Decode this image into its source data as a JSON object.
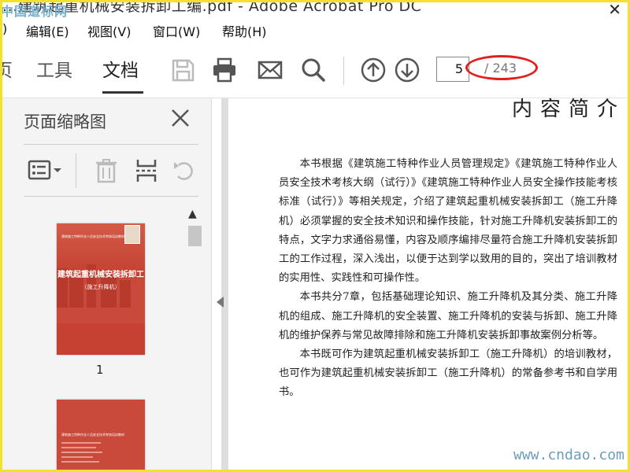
{
  "window": {
    "title": "...建筑起重机械安装拆卸工编.pdf - Adobe Acrobat Pro DC",
    "watermark_logo": "中国道标网"
  },
  "menu": [
    {
      "label": ")"
    },
    {
      "label": "编辑(E)"
    },
    {
      "label": "视图(V)"
    },
    {
      "label": "窗口(W)"
    },
    {
      "label": "帮助(H)"
    }
  ],
  "toolbar": {
    "tabs": [
      {
        "label": "页"
      },
      {
        "label": "工具"
      },
      {
        "label": "文档"
      }
    ],
    "current_page": "5",
    "total_pages": "/ 243",
    "annotation_color": "#e02020"
  },
  "sidebar": {
    "title": "页面缩略图",
    "thumbnails": [
      {
        "page_number": "1",
        "title": "建筑起重机械安装拆卸工",
        "subtitle": "（施工升降机）",
        "series": "建筑施工特种作业人员安全技术考核培训教材",
        "cover_color": "#c94a3a"
      },
      {
        "page_number": "",
        "series": "建筑施工特种作业人员安全技术考核培训教材",
        "cover_color": "#c94a3a"
      }
    ]
  },
  "document": {
    "heading": "内容简介",
    "paragraphs": [
      "本书根据《建筑施工特种作业人员管理规定》《建筑施工特种作业人员安全技术考核大纲（试行）》《建筑施工特种作业人员安全操作技能考核标准（试行）》等相关规定，介绍了建筑起重机械安装拆卸工（施工升降机）必须掌握的安全技术知识和操作技能，针对施工升降机安装拆卸工的特点，文字力求通俗易懂，内容及顺序编排尽量符合施工升降机安装拆卸工的工作过程，深入浅出，以便于达到学以致用的目的，突出了培训教材的实用性、实践性和可操作性。",
      "本书共分7章，包括基础理论知识、施工升降机及其分类、施工升降机的组成、施工升降机的安全装置、施工升降机的安装与拆卸、施工升降机的维护保养与常见故障排除和施工升降机安装拆卸事故案例分析等。",
      "本书既可作为建筑起重机械安装拆卸工（施工升降机）的培训教材，也可作为建筑起重机械安装拆卸工（施工升降机）的常备参考书和自学用书。"
    ],
    "footer_watermark": "www.cndao.com"
  }
}
